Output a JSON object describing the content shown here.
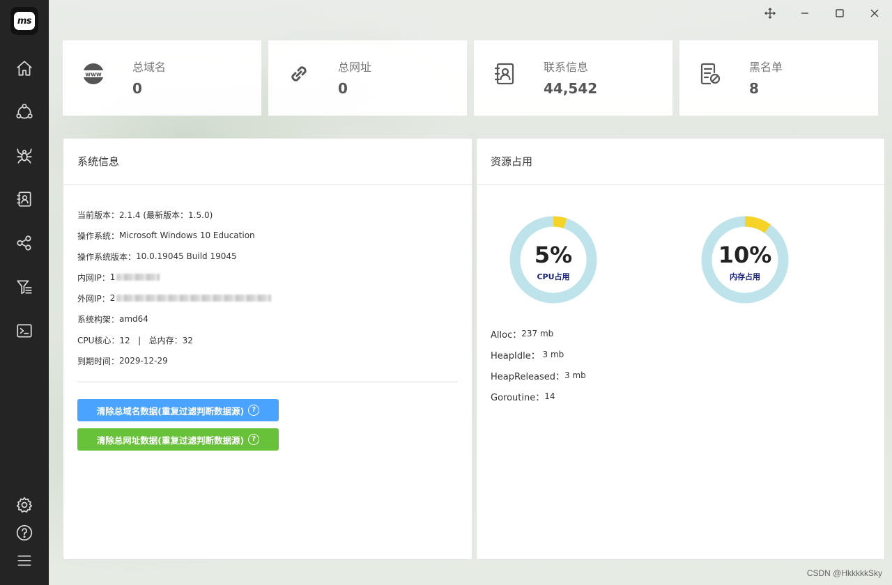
{
  "app": {
    "logo_text": "ms"
  },
  "sidebar": {
    "items": [
      {
        "icon": "home-icon"
      },
      {
        "icon": "network-icon"
      },
      {
        "icon": "spider-icon"
      },
      {
        "icon": "contacts-icon"
      },
      {
        "icon": "share-nodes-icon"
      },
      {
        "icon": "filter-icon"
      },
      {
        "icon": "terminal-icon"
      }
    ],
    "bottom": [
      {
        "icon": "gear-icon"
      },
      {
        "icon": "help-icon"
      },
      {
        "icon": "menu-icon"
      }
    ]
  },
  "window_controls": [
    "move-icon",
    "minimize-icon",
    "maximize-icon",
    "close-icon"
  ],
  "stats": [
    {
      "label": "总域名",
      "value": "0",
      "icon": "www-icon"
    },
    {
      "label": "总网址",
      "value": "0",
      "icon": "link-icon"
    },
    {
      "label": "联系信息",
      "value": "44,542",
      "icon": "contact-book-icon"
    },
    {
      "label": "黑名单",
      "value": "8",
      "icon": "blacklist-icon"
    }
  ],
  "system": {
    "title": "系统信息",
    "rows": [
      {
        "label": "当前版本：",
        "value": "2.1.4 (最新版本：1.5.0)"
      },
      {
        "label": "操作系统：",
        "value": "Microsoft Windows 10 Education"
      },
      {
        "label": "操作系统版本：",
        "value": "10.0.19045 Build 19045"
      },
      {
        "label": "内网IP：",
        "value": "1"
      },
      {
        "label": "外网IP：",
        "value": "2"
      },
      {
        "label": "系统构架：",
        "value": "amd64"
      },
      {
        "label": "CPU核心：",
        "value": "12   |   总内存：32"
      },
      {
        "label": "到期时间：",
        "value": "2029-12-29"
      }
    ],
    "buttons": {
      "clear_domains": "清除总域名数据(重复过滤判断数据源)",
      "clear_urls": "清除总网址数据(重复过滤判断数据源)",
      "help_glyph": "?"
    }
  },
  "resources": {
    "title": "资源占用",
    "cpu": {
      "percent": 5,
      "value_text": "5%",
      "label": "CPU占用"
    },
    "memory": {
      "percent": 10,
      "value_text": "10%",
      "label": "内存占用"
    },
    "ring_color": "#bfe3ea",
    "fill_color": "#f5d327",
    "stats": [
      {
        "label": "Alloc：",
        "value": "237 mb"
      },
      {
        "label": "HeapIdle：",
        "value": " 3 mb"
      },
      {
        "label": "HeapReleased：",
        "value": "3 mb"
      },
      {
        "label": "Goroutine：",
        "value": "14"
      }
    ]
  },
  "watermark": "CSDN @HkkkkkSky"
}
